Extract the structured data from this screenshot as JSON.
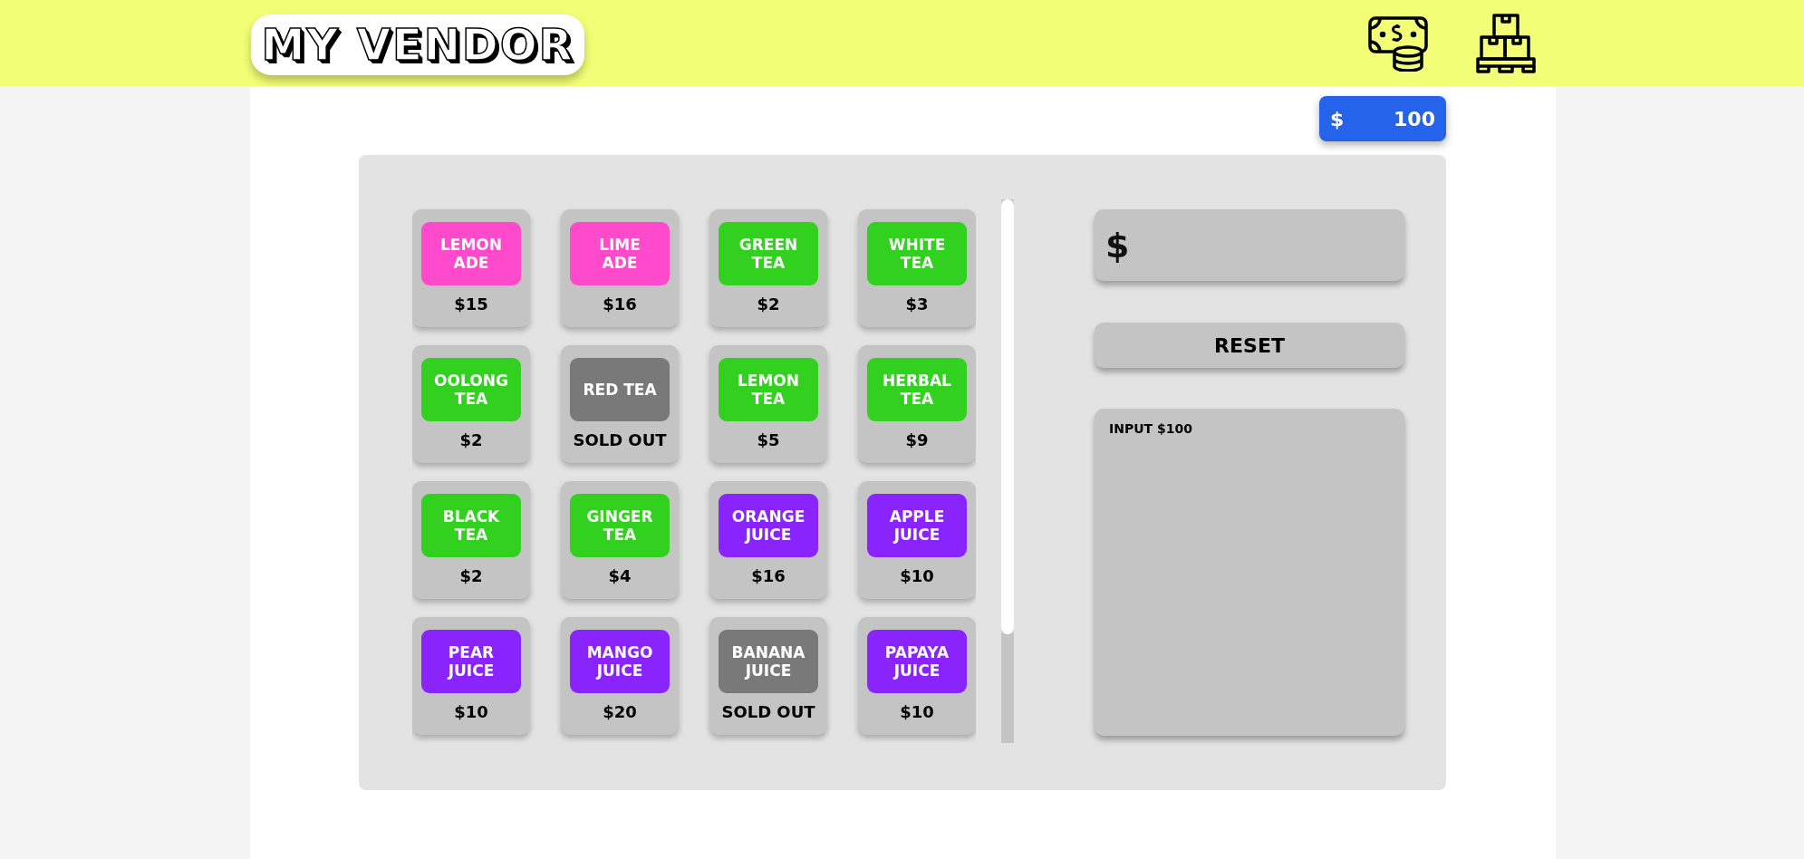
{
  "header": {
    "logo": "MY VENDOR"
  },
  "balance": {
    "currency": "$",
    "amount": "100"
  },
  "products": [
    {
      "name": "LEMON\nADE",
      "price": "$15",
      "color": "#ff4acb"
    },
    {
      "name": "LIME\nADE",
      "price": "$16",
      "color": "#ff4acb"
    },
    {
      "name": "GREEN\nTEA",
      "price": "$2",
      "color": "#33d11f"
    },
    {
      "name": "WHITE\nTEA",
      "price": "$3",
      "color": "#33d11f"
    },
    {
      "name": "OOLONG\nTEA",
      "price": "$2",
      "color": "#33d11f"
    },
    {
      "name": "RED TEA",
      "price": "SOLD OUT",
      "color": "#797979"
    },
    {
      "name": "LEMON\nTEA",
      "price": "$5",
      "color": "#33d11f"
    },
    {
      "name": "HERBAL\nTEA",
      "price": "$9",
      "color": "#33d11f"
    },
    {
      "name": "BLACK\nTEA",
      "price": "$2",
      "color": "#33d11f"
    },
    {
      "name": "GINGER\nTEA",
      "price": "$4",
      "color": "#33d11f"
    },
    {
      "name": "ORANGE\nJUICE",
      "price": "$16",
      "color": "#8a24ff"
    },
    {
      "name": "APPLE\nJUICE",
      "price": "$10",
      "color": "#8a24ff"
    },
    {
      "name": "PEAR\nJUICE",
      "price": "$10",
      "color": "#8a24ff"
    },
    {
      "name": "MANGO\nJUICE",
      "price": "$20",
      "color": "#8a24ff"
    },
    {
      "name": "BANANA\nJUICE",
      "price": "SOLD OUT",
      "color": "#797979"
    },
    {
      "name": "PAPAYA\nJUICE",
      "price": "$10",
      "color": "#8a24ff"
    }
  ],
  "money_input": {
    "prefix": "$"
  },
  "reset_button": "RESET",
  "log": [
    "INPUT $100"
  ]
}
